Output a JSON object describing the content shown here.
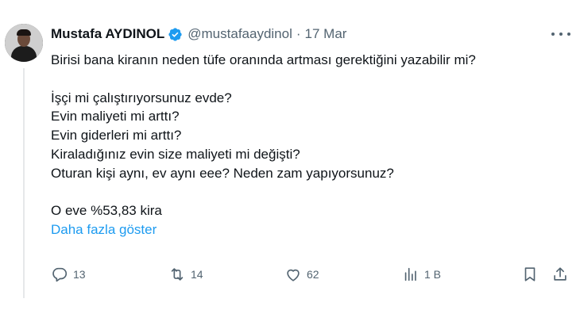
{
  "author": {
    "name": "Mustafa AYDINOL",
    "handle": "@mustafaaydinol",
    "separator": "·",
    "date": "17 Mar"
  },
  "tweet": {
    "lines": [
      "Birisi bana kiranın neden tüfe oranında artması gerektiğini yazabilir mi?",
      "",
      "İşçi mi çalıştırıyorsunuz evde?",
      "Evin maliyeti mi arttı?",
      "Evin giderleri mi arttı?",
      "Kiraladığınız evin size maliyeti mi değişti?",
      "Oturan kişi aynı, ev aynı eee? Neden zam yapıyorsunuz?",
      "",
      "O eve %53,83 kira"
    ],
    "show_more": "Daha fazla göster"
  },
  "actions": {
    "replies": "13",
    "retweets": "14",
    "likes": "62",
    "views": "1 B"
  },
  "colors": {
    "accent": "#1d9bf0",
    "muted": "#536471",
    "text": "#0f1419"
  },
  "icons": [
    "verified-badge-icon",
    "more-options-icon",
    "reply-icon",
    "retweet-icon",
    "like-icon",
    "views-icon",
    "bookmark-icon",
    "share-icon"
  ]
}
